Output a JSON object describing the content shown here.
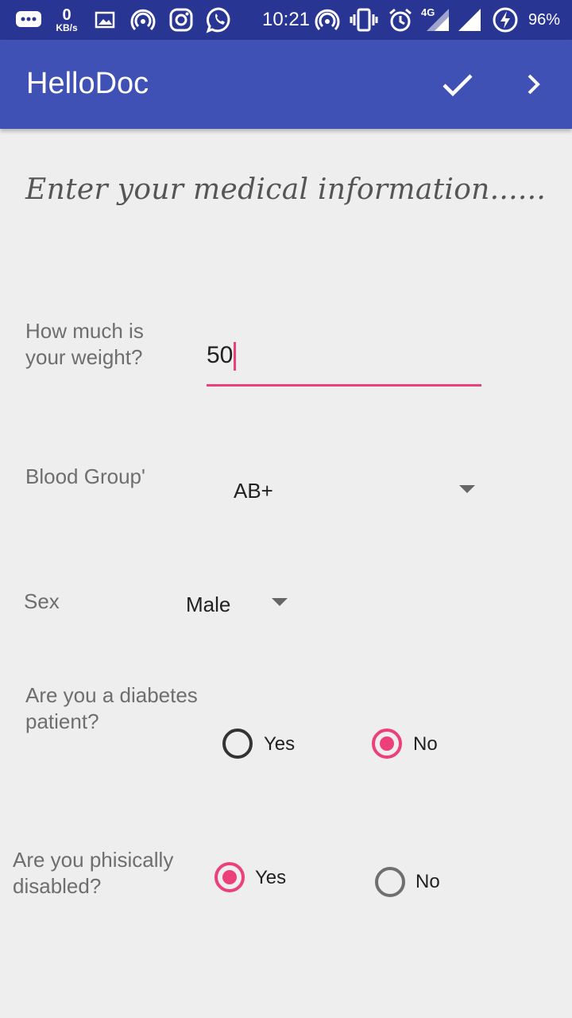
{
  "status_bar": {
    "net_speed_value": "0",
    "net_speed_unit": "KB/s",
    "time": "10:21",
    "network_type": "4G",
    "battery_percent": "96%",
    "icons": [
      "sms-icon",
      "gallery-icon",
      "hotspot-icon",
      "instagram-icon",
      "whatsapp-icon",
      "hotspot-icon",
      "vibrate-icon",
      "alarm-icon",
      "signal-icon",
      "battery-charging-icon"
    ]
  },
  "app_bar": {
    "title": "HelloDoc",
    "actions": [
      "check-icon",
      "chevron-right-icon"
    ]
  },
  "form": {
    "intro": "Enter your medical information......",
    "weight": {
      "label_line1": "How much is",
      "label_line2": "your weight?",
      "value": "50"
    },
    "blood_group": {
      "label": "Blood Group'",
      "selected": "AB+"
    },
    "sex": {
      "label": "Sex",
      "selected": "Male"
    },
    "diabetes": {
      "label_line1": "Are you a diabetes",
      "label_line2": "patient?",
      "options": [
        {
          "label": "Yes",
          "selected": false
        },
        {
          "label": "No",
          "selected": true
        }
      ]
    },
    "disabled": {
      "label_line1": "Are you phisically",
      "label_line2": "disabled?",
      "options": [
        {
          "label": "Yes",
          "selected": true
        },
        {
          "label": "No",
          "selected": false
        }
      ]
    }
  },
  "colors": {
    "primary": "#3f51b5",
    "primary_dark": "#283593",
    "accent": "#ec407a",
    "background": "#eeeeee"
  }
}
